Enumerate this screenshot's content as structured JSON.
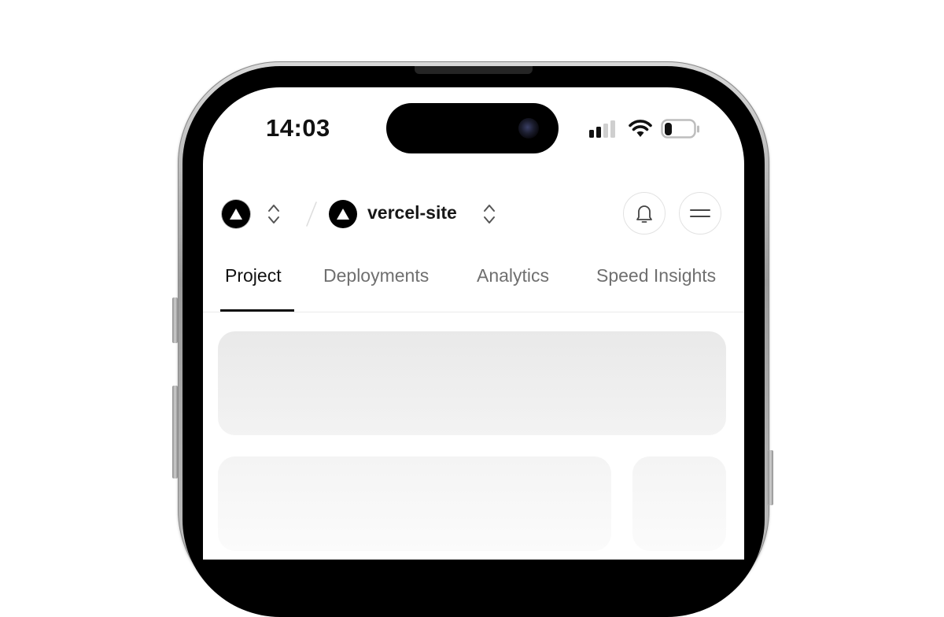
{
  "status_bar": {
    "time": "14:03",
    "icons": [
      "signal-icon",
      "wifi-icon",
      "battery-icon"
    ],
    "battery_level": 0.25
  },
  "header": {
    "team_icon": "vercel-triangle-icon",
    "switcher_icon": "chevron-up-down-icon",
    "separator_icon": "slash-icon",
    "project": {
      "name": "vercel-site",
      "icon": "vercel-triangle-icon"
    },
    "actions": [
      "bell-icon",
      "menu-icon"
    ]
  },
  "tabs": [
    {
      "label": "Project",
      "active": true
    },
    {
      "label": "Deployments",
      "active": false
    },
    {
      "label": "Analytics",
      "active": false
    },
    {
      "label": "Speed Insights",
      "active": false
    }
  ],
  "colors": {
    "text_primary": "#111111",
    "text_muted": "#6f6f6f",
    "skeleton": "#ececec",
    "brand": "#000000"
  }
}
